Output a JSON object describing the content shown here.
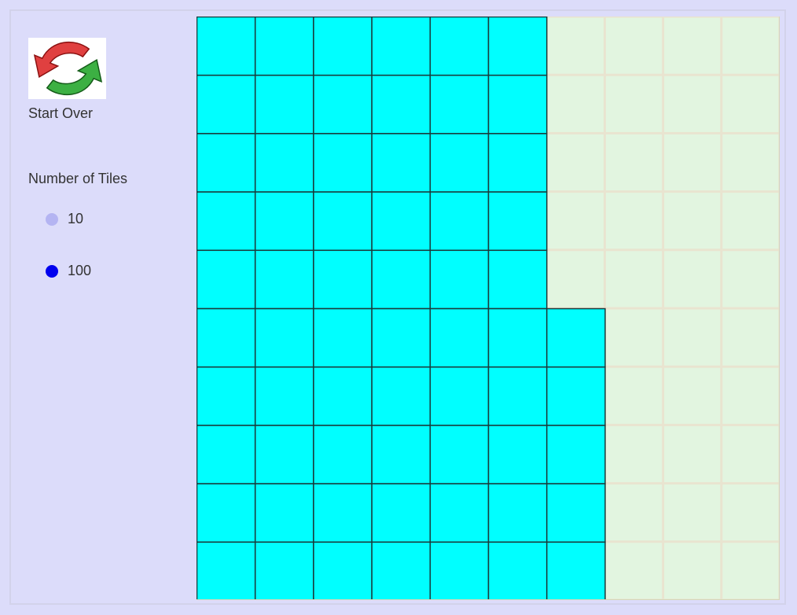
{
  "restart": {
    "label": "Start Over",
    "icon": "restart-arrows-icon"
  },
  "tile_count": {
    "heading": "Number of Tiles",
    "options": [
      {
        "label": "10",
        "selected": false
      },
      {
        "label": "100",
        "selected": true
      }
    ]
  },
  "colors": {
    "background": "#dcdcfa",
    "tile_filled": "#00ffff",
    "tile_empty": "#e2f5e0",
    "tile_border": "#1a3a3a",
    "empty_border": "#e9e4d0",
    "radio_selected": "#0000ee",
    "radio_unselected": "#b4b4f2"
  },
  "grid": {
    "rows": 10,
    "cols": 10,
    "filled_per_row": [
      6,
      6,
      6,
      6,
      6,
      7,
      7,
      7,
      7,
      7
    ]
  }
}
